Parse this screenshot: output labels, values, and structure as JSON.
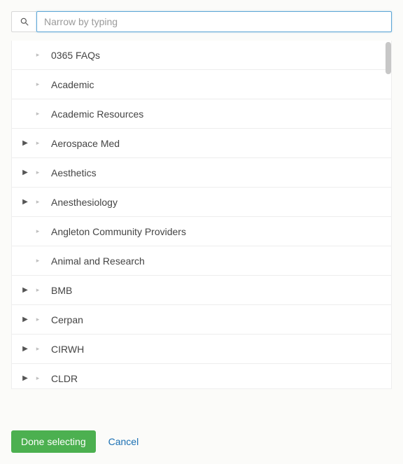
{
  "search": {
    "placeholder": "Narrow by typing",
    "value": ""
  },
  "list": {
    "items": [
      {
        "label": "0365 FAQs",
        "expandable": false
      },
      {
        "label": "Academic",
        "expandable": false
      },
      {
        "label": "Academic Resources",
        "expandable": false
      },
      {
        "label": "Aerospace Med",
        "expandable": true
      },
      {
        "label": "Aesthetics",
        "expandable": true
      },
      {
        "label": "Anesthesiology",
        "expandable": true
      },
      {
        "label": "Angleton Community Providers",
        "expandable": false
      },
      {
        "label": "Animal and Research",
        "expandable": false
      },
      {
        "label": "BMB",
        "expandable": true
      },
      {
        "label": "Cerpan",
        "expandable": true
      },
      {
        "label": "CIRWH",
        "expandable": true
      },
      {
        "label": "CLDR",
        "expandable": true
      }
    ]
  },
  "footer": {
    "done_label": "Done selecting",
    "cancel_label": "Cancel"
  },
  "colors": {
    "primary_button": "#4cb050",
    "link": "#1a6fb3",
    "focus_border": "#5fa7d6"
  }
}
